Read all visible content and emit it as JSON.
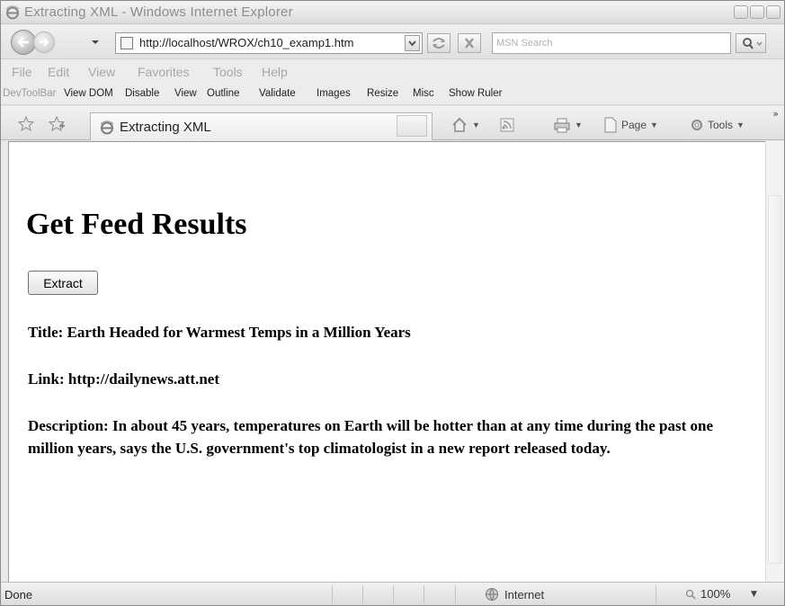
{
  "window": {
    "title": "Extracting XML - Windows Internet Explorer"
  },
  "address_bar": {
    "url": "http://localhost/WROX/ch10_examp1.htm",
    "search_placeholder": "MSN Search"
  },
  "menu_bar": {
    "items": [
      "File",
      "Edit",
      "View",
      "Favorites",
      "Tools",
      "Help"
    ]
  },
  "dev_toolbar": {
    "items": [
      "DevToolBar",
      "View DOM",
      "Disable",
      "View",
      "Outline",
      "Validate",
      "Images",
      "Resize",
      "Misc",
      "Show Ruler"
    ]
  },
  "tab_bar": {
    "active_tab_label": "Extracting XML",
    "page_label": "Page",
    "tools_label": "Tools"
  },
  "content": {
    "heading": "Get Feed Results",
    "extract_button_label": "Extract",
    "title_line": "Title: Earth Headed for Warmest Temps in a Million Years",
    "link_line": "Link: http://dailynews.att.net",
    "description_line": "Description: In about 45 years, temperatures on Earth will be hotter than at any time during the past one million years, says the U.S. government's top climatologist in a new report released today."
  },
  "status_bar": {
    "status": "Done",
    "zone": "Internet",
    "zoom": "100%"
  },
  "icons": {
    "browser_logo": "ie-logo-icon",
    "back": "back-arrow-icon",
    "forward": "forward-arrow-icon",
    "refresh": "refresh-icon",
    "stop": "stop-icon",
    "search": "magnifier-icon",
    "favorites": "star-icon",
    "add_favorites": "add-star-icon",
    "home": "home-icon",
    "feeds": "feed-icon",
    "print": "print-icon",
    "page": "page-icon",
    "tools": "gear-icon",
    "internet_zone": "globe-icon"
  }
}
